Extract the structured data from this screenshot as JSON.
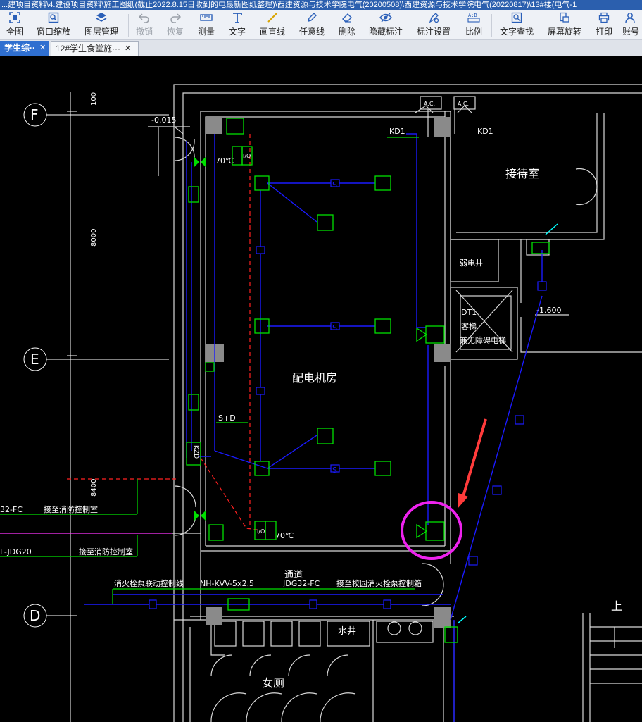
{
  "window": {
    "title": "...建项目资料\\4.建设项目资料\\施工图纸(截止2022.8.15日收到的电最新图纸整理)\\西建资源与技术学院电气(20200508)\\西建资源与技术学院电气(20220817)\\13#楼(电气-1"
  },
  "toolbar": {
    "buttons": [
      {
        "id": "fit-all",
        "label": "全图",
        "icon": "fit-all-icon",
        "enabled": true
      },
      {
        "id": "window-zoom",
        "label": "窗口缩放",
        "icon": "zoom-window-icon",
        "enabled": true
      },
      {
        "id": "layer-manage",
        "label": "图层管理",
        "icon": "layers-icon",
        "enabled": true
      },
      {
        "id": "undo",
        "label": "撤销",
        "icon": "undo-icon",
        "enabled": false
      },
      {
        "id": "redo",
        "label": "恢复",
        "icon": "redo-icon",
        "enabled": false
      },
      {
        "id": "measure",
        "label": "测量",
        "icon": "measure-icon",
        "enabled": true
      },
      {
        "id": "text",
        "label": "文字",
        "icon": "text-icon",
        "enabled": true
      },
      {
        "id": "line",
        "label": "画直线",
        "icon": "line-icon",
        "enabled": true
      },
      {
        "id": "freeline",
        "label": "任意线",
        "icon": "pen-icon",
        "enabled": true
      },
      {
        "id": "delete",
        "label": "删除",
        "icon": "eraser-icon",
        "enabled": true
      },
      {
        "id": "hide-annot",
        "label": "隐藏标注",
        "icon": "eye-hidden-icon",
        "enabled": true
      },
      {
        "id": "annot-settings",
        "label": "标注设置",
        "icon": "annotation-settings-icon",
        "enabled": true
      },
      {
        "id": "scale",
        "label": "比例",
        "icon": "scale-icon",
        "enabled": true
      },
      {
        "id": "find-text",
        "label": "文字查找",
        "icon": "find-text-icon",
        "enabled": true
      },
      {
        "id": "rotate",
        "label": "屏幕旋转",
        "icon": "rotate-screen-icon",
        "enabled": true
      },
      {
        "id": "print",
        "label": "打印",
        "icon": "printer-icon",
        "enabled": true
      },
      {
        "id": "account",
        "label": "账号",
        "icon": "user-icon",
        "enabled": true
      }
    ]
  },
  "tabs": [
    {
      "label": "学生综··",
      "active": true,
      "close": "✕"
    },
    {
      "label": "12#学生食堂施···",
      "active": false,
      "close": "✕"
    }
  ],
  "drawing": {
    "labels": {
      "axis_F": "F",
      "axis_E": "E",
      "axis_D": "D",
      "dim_100": "100",
      "dim_8000": "8000",
      "dim_8400": "8400",
      "level_neg0015": "-0.015",
      "level_neg1600": "-1.600",
      "kd1_left": "KD1",
      "kd1_right": "KD1",
      "ac1": "A.C.",
      "ac2": "A.C.",
      "reception": "接待室",
      "weak_well": "弱电井",
      "elevator_dt1": "DT1",
      "elevator_text1": "客梯",
      "elevator_text2": "兼无障碍电梯",
      "distribution_room": "配电机房",
      "temp_70_top": "70℃",
      "temp_70_bottom": "70℃",
      "io_top": "I/O",
      "io_bottom": "I/O",
      "sd": "S+D",
      "kzd": "KZD",
      "s_marker": "S",
      "fc32": "32-FC",
      "to_fire_control_1": "接至消防控制室",
      "jdg20": "L-JDG20",
      "to_fire_control_2": "接至消防控制室",
      "hydrant_line": "消火栓泵联动控制线",
      "nh_kvv": "NH-KVV-5x2.5",
      "jdg32fc": "JDG32-FC",
      "to_campus_box": "接至校园消火栓泵控制箱",
      "corridor": "通道",
      "water_well": "水井",
      "womens_wc": "女厕",
      "up": "上"
    },
    "colors": {
      "wall": "#d9d9d9",
      "green": "#00e000",
      "blue": "#1a1aff",
      "red": "#ff2020",
      "magenta": "#ff33ff",
      "annotation_arrow": "#ff3b3b",
      "annotation_circle": "#ee22ee",
      "cyan": "#00ffff"
    }
  }
}
